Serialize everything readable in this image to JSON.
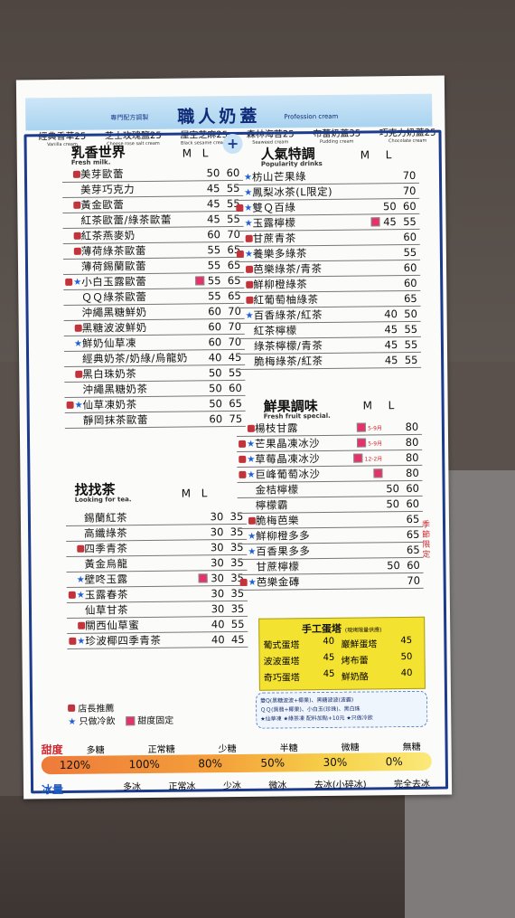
{
  "brand": {
    "small": "專門配方調製",
    "title": "職人奶蓋",
    "sub": "Profession cream"
  },
  "top_items": [
    {
      "name": "經典香草25",
      "en": "Vanilla cream"
    },
    {
      "name": "芝士玫瑰鹽25",
      "en": "Cheese rose salt cream"
    },
    {
      "name": "屋空芝麻25",
      "en": "Black sesame cream"
    },
    {
      "name": "森林海苔25",
      "en": "Seaweed cream"
    },
    {
      "name": "布蕾奶蓋35",
      "en": "Pudding cream"
    },
    {
      "name": "巧克力奶蓋25",
      "en": "Chocolate cream"
    }
  ],
  "plus": "+",
  "sections": {
    "milk": {
      "title": "乳香世界",
      "en": "Fresh milk.",
      "m": "M",
      "l": "L"
    },
    "popular": {
      "title": "人氣特調",
      "en": "Popularity drinks",
      "m": "M",
      "l": "L"
    },
    "fruit": {
      "title": "鮮果調味",
      "en": "Fresh fruit special.",
      "m": "M",
      "l": "L"
    },
    "tea": {
      "title": "找找茶",
      "en": "Looking for tea.",
      "m": "M",
      "l": "L"
    }
  },
  "milk_items": [
    {
      "name": "美芽歐蕾",
      "m": "50",
      "l": "60",
      "thumb": true
    },
    {
      "name": "美芽巧克力",
      "m": "45",
      "l": "55"
    },
    {
      "name": "黃金歐蕾",
      "m": "45",
      "l": "55",
      "thumb": true
    },
    {
      "name": "紅茶歐蕾/綠茶歐蕾",
      "m": "45",
      "l": "55"
    },
    {
      "name": "紅茶燕麥奶",
      "m": "60",
      "l": "70",
      "thumb": true
    },
    {
      "name": "薄荷綠茶歐蕾",
      "m": "55",
      "l": "65",
      "thumb": true
    },
    {
      "name": "薄荷錫蘭歐蕾",
      "m": "55",
      "l": "65"
    },
    {
      "name": "小白玉露歐蕾",
      "m": "55",
      "l": "65",
      "thumb": true,
      "star": true,
      "sq": true
    },
    {
      "name": "ＱＱ綠茶歐蕾",
      "m": "55",
      "l": "65"
    },
    {
      "name": "沖繩黑糖鮮奶",
      "m": "60",
      "l": "70"
    },
    {
      "name": "黑糖波波鮮奶",
      "m": "60",
      "l": "70",
      "thumb": true
    },
    {
      "name": "鮮奶仙草凍",
      "m": "60",
      "l": "70",
      "star": true
    },
    {
      "name": "經典奶茶/奶綠/烏龍奶",
      "m": "40",
      "l": "45"
    },
    {
      "name": "黑白珠奶茶",
      "m": "50",
      "l": "55",
      "thumb": true
    },
    {
      "name": "沖繩黑糖奶茶",
      "m": "50",
      "l": "60"
    },
    {
      "name": "仙草凍奶茶",
      "m": "50",
      "l": "65",
      "thumb": true,
      "star": true
    },
    {
      "name": "靜岡抹茶歐蕾",
      "m": "60",
      "l": "75"
    }
  ],
  "popular_items": [
    {
      "name": "枋山芒果綠",
      "m": "",
      "l": "70",
      "star": true
    },
    {
      "name": "鳳梨冰茶(L限定)",
      "m": "",
      "l": "70",
      "star": true
    },
    {
      "name": "雙Ｑ百綠",
      "m": "50",
      "l": "60",
      "thumb": true,
      "star": true
    },
    {
      "name": "玉露檸檬",
      "m": "45",
      "l": "55",
      "star": true,
      "sq": true
    },
    {
      "name": "甘蔗青茶",
      "m": "",
      "l": "60",
      "thumb": true
    },
    {
      "name": "養樂多綠茶",
      "m": "",
      "l": "55",
      "thumb": true,
      "star": true
    },
    {
      "name": "芭樂綠茶/青茶",
      "m": "",
      "l": "60",
      "thumb": true
    },
    {
      "name": "鮮柳橙綠茶",
      "m": "",
      "l": "60",
      "thumb": true
    },
    {
      "name": "紅葡萄柚綠茶",
      "m": "",
      "l": "65",
      "thumb": true
    },
    {
      "name": "百香綠茶/紅茶",
      "m": "40",
      "l": "50",
      "star": true
    },
    {
      "name": "紅茶檸檬",
      "m": "45",
      "l": "55"
    },
    {
      "name": "綠茶檸檬/青茶",
      "m": "45",
      "l": "55"
    },
    {
      "name": "脆梅綠茶/紅茶",
      "m": "45",
      "l": "55"
    }
  ],
  "fruit_items": [
    {
      "name": "楊枝甘露",
      "season": "5-9月",
      "m": "",
      "l": "80",
      "thumb": true,
      "sq": true
    },
    {
      "name": "芒果晶凍冰沙",
      "season": "5-9月",
      "m": "",
      "l": "80",
      "thumb": true,
      "star": true,
      "sq": true
    },
    {
      "name": "草莓晶凍冰沙",
      "season": "12-2月",
      "m": "",
      "l": "80",
      "thumb": true,
      "star": true,
      "sq": true
    },
    {
      "name": "巨峰葡萄冰沙",
      "m": "",
      "l": "80",
      "thumb": true,
      "star": true,
      "sq": true
    },
    {
      "name": "金桔檸檬",
      "m": "50",
      "l": "60"
    },
    {
      "name": "檸檬霸",
      "m": "50",
      "l": "60"
    },
    {
      "name": "脆梅芭樂",
      "m": "",
      "l": "65",
      "thumb": true
    },
    {
      "name": "鮮柳橙多多",
      "m": "",
      "l": "65",
      "star": true
    },
    {
      "name": "百香果多多",
      "m": "",
      "l": "65",
      "star": true
    },
    {
      "name": "甘蔗檸檬",
      "m": "50",
      "l": "60"
    },
    {
      "name": "芭樂金磚",
      "m": "",
      "l": "70",
      "thumb": true,
      "star": true
    }
  ],
  "season_label": "季節限定",
  "tea_items": [
    {
      "name": "錫蘭紅茶",
      "m": "30",
      "l": "35"
    },
    {
      "name": "高纖綠茶",
      "m": "30",
      "l": "35"
    },
    {
      "name": "四季青茶",
      "m": "30",
      "l": "35",
      "thumb": true
    },
    {
      "name": "黃金烏龍",
      "m": "30",
      "l": "35"
    },
    {
      "name": "壁咚玉露",
      "m": "30",
      "l": "35",
      "star": true,
      "sq": true
    },
    {
      "name": "玉露春茶",
      "m": "30",
      "l": "35",
      "thumb": true,
      "star": true
    },
    {
      "name": "仙草甘茶",
      "m": "30",
      "l": "35"
    },
    {
      "name": "關西仙草蜜",
      "m": "40",
      "l": "55",
      "thumb": true
    },
    {
      "name": "珍波椰四季青茶",
      "m": "40",
      "l": "45",
      "thumb": true,
      "star": true
    }
  ],
  "tart": {
    "title": "手工蛋塔",
    "note": "(現烤限量供應)",
    "items": [
      {
        "name": "葡式蛋塔",
        "price": "40"
      },
      {
        "name": "巖鮮蛋塔",
        "price": "45"
      },
      {
        "name": "波波蛋塔",
        "price": "45"
      },
      {
        "name": "烤布蕾",
        "price": "50"
      },
      {
        "name": "奇巧蛋塔",
        "price": "45"
      },
      {
        "name": "鮮奶酪",
        "price": "40"
      }
    ]
  },
  "notes": [
    "雙Q(黑糖波波+椰果)、黑糖波波(波霸)",
    "ＱＱ(蒟蒻+椰果)、小白玉(珍珠)、黑白珠",
    "★仙草凍 ★綠茶凍  配料加點+10元 ★只做冷飲"
  ],
  "legend": {
    "recommend": "店長推薦",
    "cold_only": "只做冷飲",
    "fixed_sweet": "甜度固定"
  },
  "sweetness": {
    "label": "甜度",
    "options": [
      "多糖",
      "正常糖",
      "少糖",
      "半糖",
      "微糖",
      "無糖"
    ],
    "values": [
      "120%",
      "100%",
      "80%",
      "50%",
      "30%",
      "0%"
    ]
  },
  "ice": {
    "label": "冰量",
    "options": [
      "多冰",
      "正常冰",
      "少冰",
      "微冰",
      "去冰(小碎冰)",
      "完全去冰"
    ]
  }
}
